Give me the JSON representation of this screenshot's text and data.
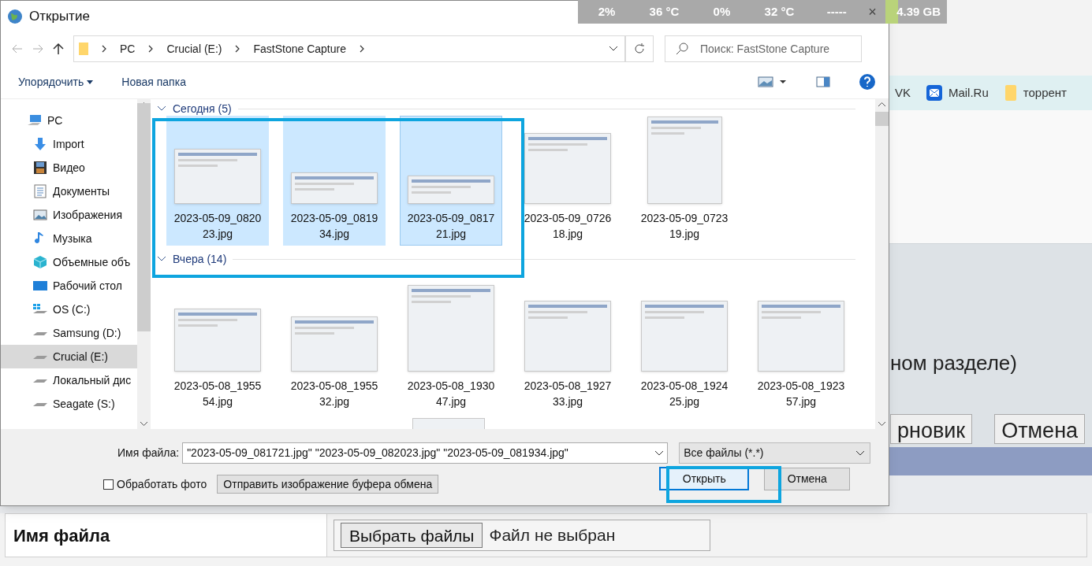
{
  "window": {
    "title": "Открытие"
  },
  "address": {
    "crumbs": [
      "PC",
      "Crucial (E:)",
      "FastStone Capture"
    ]
  },
  "search": {
    "placeholder": "Поиск: FastStone Capture"
  },
  "toolbar": {
    "organize": "Упорядочить",
    "new_folder": "Новая папка"
  },
  "sidebar": {
    "items": [
      {
        "label": "PC",
        "kind": "pc",
        "selected": false
      },
      {
        "label": "Import",
        "kind": "download",
        "selected": false
      },
      {
        "label": "Видео",
        "kind": "video",
        "selected": false
      },
      {
        "label": "Документы",
        "kind": "document",
        "selected": false
      },
      {
        "label": "Изображения",
        "kind": "image",
        "selected": false
      },
      {
        "label": "Музыка",
        "kind": "music",
        "selected": false
      },
      {
        "label": "Объемные объ",
        "kind": "cube",
        "selected": false
      },
      {
        "label": "Рабочий стол",
        "kind": "desktop",
        "selected": false
      },
      {
        "label": "OS (C:)",
        "kind": "os-drive",
        "selected": false
      },
      {
        "label": "Samsung (D:)",
        "kind": "drive",
        "selected": false
      },
      {
        "label": "Crucial (E:)",
        "kind": "drive",
        "selected": true
      },
      {
        "label": "Локальный дис",
        "kind": "drive",
        "selected": false
      },
      {
        "label": "Seagate (S:)",
        "kind": "drive",
        "selected": false
      }
    ]
  },
  "groups": [
    {
      "label": "Сегодня (5)",
      "files": [
        {
          "name": "2023-05-09_082023.jpg",
          "selected": true,
          "focused": false
        },
        {
          "name": "2023-05-09_081934.jpg",
          "selected": true,
          "focused": false
        },
        {
          "name": "2023-05-09_081721.jpg",
          "selected": true,
          "focused": true
        },
        {
          "name": "2023-05-09_072618.jpg",
          "selected": false,
          "focused": false
        },
        {
          "name": "2023-05-09_072319.jpg",
          "selected": false,
          "focused": false
        }
      ]
    },
    {
      "label": "Вчера (14)",
      "files": [
        {
          "name": "2023-05-08_195554.jpg",
          "selected": false,
          "focused": false
        },
        {
          "name": "2023-05-08_195532.jpg",
          "selected": false,
          "focused": false
        },
        {
          "name": "2023-05-08_193047.jpg",
          "selected": false,
          "focused": false
        },
        {
          "name": "2023-05-08_192733.jpg",
          "selected": false,
          "focused": false
        },
        {
          "name": "2023-05-08_192425.jpg",
          "selected": false,
          "focused": false
        },
        {
          "name": "2023-05-08_192357.jpg",
          "selected": false,
          "focused": false
        }
      ]
    }
  ],
  "filename": {
    "label": "Имя файла:",
    "value": "\"2023-05-09_081721.jpg\" \"2023-05-09_082023.jpg\" \"2023-05-09_081934.jpg\""
  },
  "filter": {
    "value": "Все файлы (*.*)"
  },
  "process_photo": {
    "label": "Обработать фото",
    "checked": false
  },
  "buttons": {
    "clipboard": "Отправить изображение буфера обмена",
    "open": "Открыть",
    "cancel": "Отмена"
  },
  "monitor": {
    "readings": [
      "2%",
      "36 °C",
      "0%",
      "32 °C",
      "-----"
    ],
    "close": "×",
    "memory": "4.39 GB"
  },
  "page": {
    "bookmarks": [
      {
        "label": "VK",
        "kind": "vk"
      },
      {
        "label": "Mail.Ru",
        "kind": "mail"
      },
      {
        "label": "торрент",
        "kind": "folder"
      }
    ],
    "section_text": "ном разделе)",
    "buttons": [
      "рновик",
      "Отмена"
    ],
    "file_row": {
      "label": "Имя файла",
      "button": "Выбрать файлы",
      "status": "Файл не выбран"
    }
  }
}
